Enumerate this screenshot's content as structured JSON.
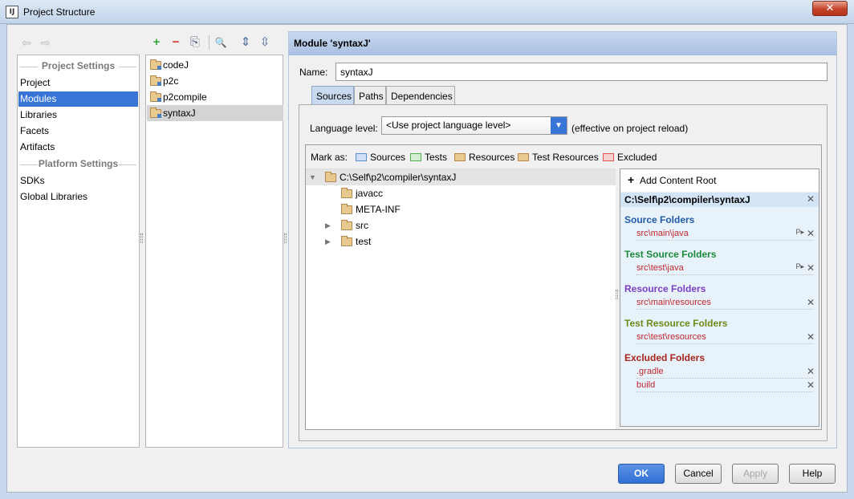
{
  "window": {
    "title": "Project Structure",
    "close_glyph": "✕"
  },
  "nav": {
    "back_glyph": "⇦",
    "forward_glyph": "⇨",
    "group1": "Project Settings",
    "group2": "Platform Settings",
    "items": [
      "Project",
      "Modules",
      "Libraries",
      "Facets",
      "Artifacts"
    ],
    "platform_items": [
      "SDKs",
      "Global Libraries"
    ],
    "selected": "Modules"
  },
  "toolbar": {
    "add": "+",
    "remove": "−",
    "copy": "⎘",
    "find": "🔍",
    "expand": "⇕",
    "collapse": "⇳"
  },
  "modules": [
    "codeJ",
    "p2c",
    "p2compile",
    "syntaxJ"
  ],
  "module_panel": {
    "header": "Module 'syntaxJ'",
    "name_label": "Name:",
    "name_value": "syntaxJ",
    "tabs": [
      "Sources",
      "Paths",
      "Dependencies"
    ],
    "language_label": "Language level:",
    "language_value": "<Use project language level>",
    "language_note": "(effective on project reload)",
    "mark_as_label": "Mark as:",
    "mark_as": [
      {
        "label": "Sources",
        "color": "#5b8dd6"
      },
      {
        "label": "Tests",
        "color": "#4caf50"
      },
      {
        "label": "Resources",
        "color": "#c9954a"
      },
      {
        "label": "Test Resources",
        "color": "#c9954a"
      },
      {
        "label": "Excluded",
        "color": "#d9534f"
      }
    ],
    "tree": {
      "root": "C:\\Self\\p2\\compiler\\syntaxJ",
      "children": [
        "javacc",
        "META-INF",
        "src",
        "test"
      ]
    },
    "content_root": {
      "add_label": "Add Content Root",
      "path": "C:\\Self\\p2\\compiler\\syntaxJ",
      "sections": [
        {
          "title": "Source Folders",
          "color": "#1f5ba6",
          "items": [
            "src\\main\\java"
          ]
        },
        {
          "title": "Test Source Folders",
          "color": "#1b8a3a",
          "items": [
            "src\\test\\java"
          ]
        },
        {
          "title": "Resource Folders",
          "color": "#7b3fc4",
          "items": [
            "src\\main\\resources"
          ]
        },
        {
          "title": "Test Resource Folders",
          "color": "#6e8b1a",
          "items": [
            "src\\test\\resources"
          ]
        },
        {
          "title": "Excluded Folders",
          "color": "#a8241b",
          "items": [
            ".gradle",
            "build"
          ]
        }
      ]
    }
  },
  "buttons": {
    "ok": "OK",
    "cancel": "Cancel",
    "apply": "Apply",
    "help": "Help"
  }
}
